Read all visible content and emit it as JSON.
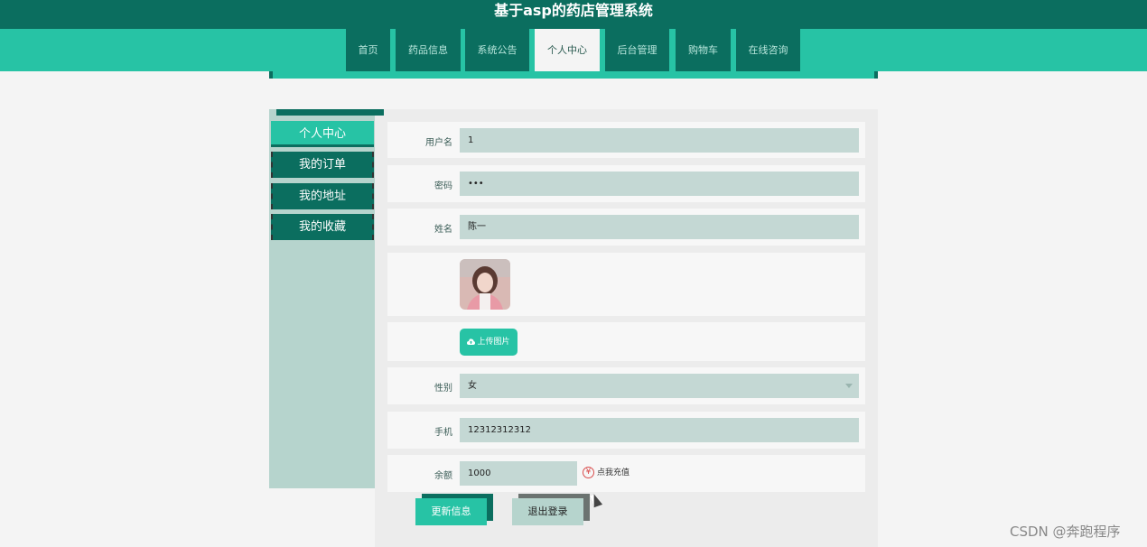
{
  "header": {
    "site_title": "基于asp的药店管理系统"
  },
  "nav": {
    "items": [
      {
        "label": "首页",
        "active": false
      },
      {
        "label": "药品信息",
        "active": false
      },
      {
        "label": "系统公告",
        "active": false
      },
      {
        "label": "个人中心",
        "active": true
      },
      {
        "label": "后台管理",
        "active": false
      },
      {
        "label": "购物车",
        "active": false
      },
      {
        "label": "在线咨询",
        "active": false
      }
    ]
  },
  "sidebar": {
    "items": [
      {
        "label": "个人中心",
        "active": true
      },
      {
        "label": "我的订单",
        "active": false
      },
      {
        "label": "我的地址",
        "active": false
      },
      {
        "label": "我的收藏",
        "active": false
      }
    ]
  },
  "form": {
    "username_label": "用户名",
    "username_value": "1",
    "password_label": "密码",
    "password_value": "•••",
    "name_label": "姓名",
    "name_value": "陈一",
    "upload_label": "上传图片",
    "gender_label": "性别",
    "gender_value": "女",
    "phone_label": "手机",
    "phone_value": "12312312312",
    "balance_label": "余额",
    "balance_value": "1000",
    "recharge_icon": "¥",
    "recharge_label": "点我充值"
  },
  "actions": {
    "update_label": "更新信息",
    "logout_label": "退出登录"
  },
  "watermark": "CSDN @奔跑程序",
  "colors": {
    "primary_dark": "#0b6e5f",
    "primary": "#27c3a5",
    "field_bg": "#c4d8d4",
    "sidebar_bg": "#b6d4cd"
  },
  "icons": {
    "upload": "cloud-upload-icon",
    "recharge": "yuan-icon",
    "select": "chevron-down-icon",
    "avatar": "user-photo"
  }
}
